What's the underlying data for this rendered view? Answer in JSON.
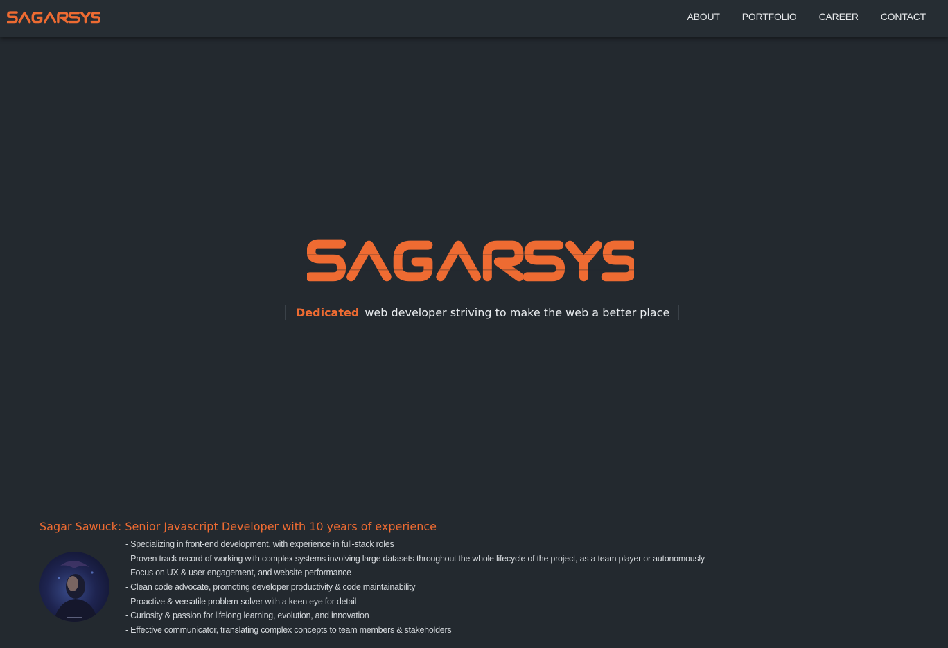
{
  "brand": {
    "name": "SAGARSYS",
    "color": "#ee6b32"
  },
  "nav": {
    "items": [
      {
        "label": "ABOUT"
      },
      {
        "label": "PORTFOLIO"
      },
      {
        "label": "CAREER"
      },
      {
        "label": "CONTACT"
      }
    ]
  },
  "hero": {
    "logo_text": "SAGARSYS",
    "tagline_highlight": "Dedicated",
    "tagline_rest": "web developer striving to make the web a better place"
  },
  "about": {
    "title": "Sagar Sawuck: Senior Javascript Developer with 10 years of experience",
    "avatar_icon": "profile-photo",
    "bullets": [
      "- Specializing in front-end development, with experience in full-stack roles",
      "- Proven track record of working with complex systems involving large datasets throughout the whole lifecycle of the project, as a team player or autonomously",
      "- Focus on UX & user engagement, and website performance",
      "- Clean code advocate, promoting developer productivity & code maintainability",
      "- Proactive & versatile problem-solver with a keen eye for detail",
      "- Curiosity & passion for lifelong learning, evolution, and innovation",
      "- Effective communicator, translating complex concepts to team members & stakeholders"
    ]
  },
  "colors": {
    "background": "#23292f",
    "topbar": "#262d33",
    "accent": "#ee6b32",
    "text": "#e6e8ea"
  }
}
